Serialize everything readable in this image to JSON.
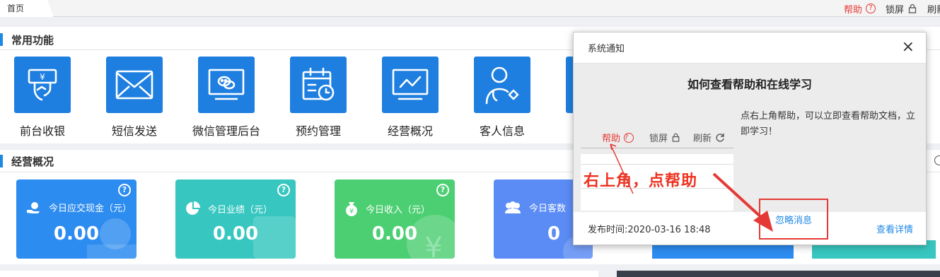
{
  "tabs": [
    {
      "label": "首页"
    }
  ],
  "topbar": {
    "help_label": "帮助",
    "lock_label": "锁屏",
    "refresh_label": "刷新"
  },
  "common_functions": {
    "title": "常用功能",
    "items": [
      {
        "label": "前台收银",
        "icon": "cashier-icon"
      },
      {
        "label": "短信发送",
        "icon": "envelope-icon"
      },
      {
        "label": "微信管理后台",
        "icon": "wechat-monitor-icon"
      },
      {
        "label": "预约管理",
        "icon": "calendar-clock-icon"
      },
      {
        "label": "经营概况",
        "icon": "line-chart-icon"
      },
      {
        "label": "客人信息",
        "icon": "customer-icon"
      }
    ]
  },
  "business_overview": {
    "title": "经营概况",
    "cards": [
      {
        "label": "今日应交现金（元）",
        "value": "0.00",
        "color": "#2d8cf0",
        "icon": "cash-hand-icon",
        "help": "?"
      },
      {
        "label": "今日业绩（元）",
        "value": "0.00",
        "color": "#37c7c0",
        "icon": "pie-chart-icon",
        "help": "?"
      },
      {
        "label": "今日收入（元）",
        "value": "0.00",
        "color": "#4ccf72",
        "icon": "money-bag-icon",
        "help": "?"
      },
      {
        "label": "今日客数",
        "value": "0",
        "color": "#5b8cf5",
        "icon": "people-icon",
        "help": ""
      }
    ]
  },
  "modal": {
    "header": "系统通知",
    "title": "如何查看帮助和在线学习",
    "screenshot": {
      "help_label": "帮助",
      "lock_label": "锁屏",
      "refresh_label": "刷新",
      "annotation": "右上角，点帮助"
    },
    "description": "点右上角帮助，可以立即查看帮助文档，立即学习！",
    "publish_time": "发布时间:2020-03-16 18:48",
    "ignore_label": "忽略消息",
    "detail_label": "查看详情"
  }
}
